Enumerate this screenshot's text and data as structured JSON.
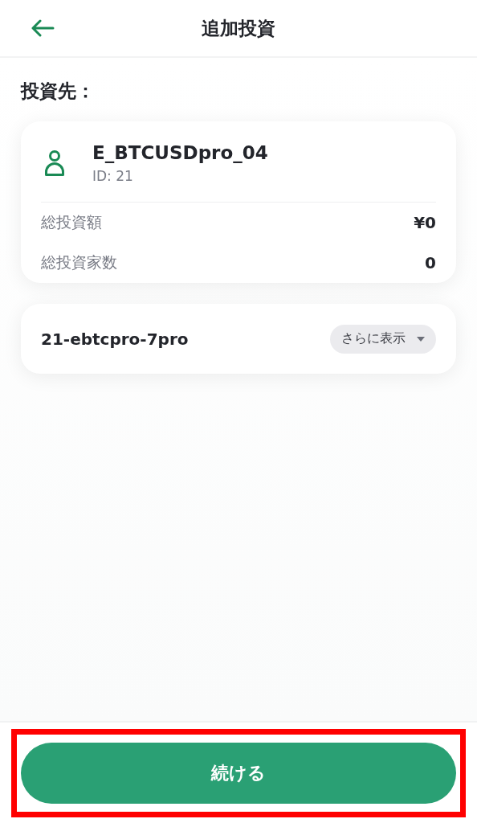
{
  "header": {
    "title": "追加投資"
  },
  "section_title": "投資先：",
  "strategy_card": {
    "name": "E_BTCUSDpro_04",
    "id": "ID: 21",
    "stats": [
      {
        "label": "総投資額",
        "value": "¥0"
      },
      {
        "label": "総投資家数",
        "value": "0"
      }
    ]
  },
  "version_card": {
    "name": "21-ebtcpro-7pro",
    "more_button": "さらに表示"
  },
  "continue_button": {
    "label": "続ける",
    "highlighted": true
  }
}
